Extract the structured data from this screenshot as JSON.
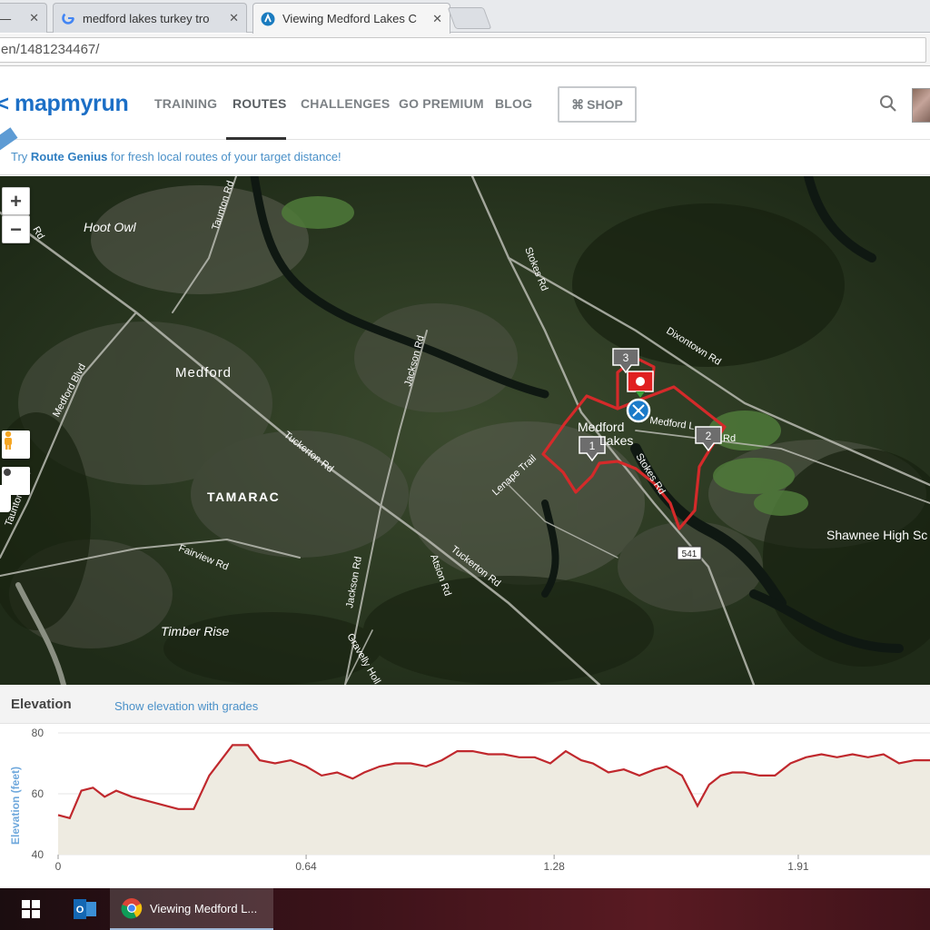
{
  "browser": {
    "tabs": [
      {
        "title": "k —",
        "favicon": "page-icon"
      },
      {
        "title": "medford lakes turkey tro",
        "favicon": "google-g-icon"
      },
      {
        "title": "Viewing Medford Lakes C",
        "favicon": "mapmyrun-icon"
      }
    ],
    "url": "en/1481234467/"
  },
  "site": {
    "logo": "mapmyrun",
    "nav": [
      "TRAINING",
      "ROUTES",
      "CHALLENGES",
      "GO PREMIUM",
      "BLOG"
    ],
    "active_nav": "ROUTES",
    "shop_label": "SHOP",
    "brand_color": "#1c6fc6"
  },
  "banner": {
    "prefix": "Try ",
    "highlight": "Route Genius",
    "suffix": " for fresh local routes of your target distance!"
  },
  "map": {
    "zoom_in": "+",
    "zoom_out": "−",
    "place_labels": {
      "hoot_owl": "Hoot Owl",
      "medford": "Medford",
      "tamarac": "TAMARAC",
      "timber_rise": "Timber Rise",
      "medford_lakes_1": "Medford",
      "medford_lakes_2": "Lakes",
      "shawnee": "Shawnee High Sc"
    },
    "road_labels": {
      "taunton_rd": "Taunton Rd",
      "stokes_rd_n": "Stokes Rd",
      "dixontown_rd": "Dixontown Rd",
      "jackson_rd_n": "Jackson Rd",
      "medford_blvd": "Medford Blvd",
      "tuckerton_rd_1": "Tuckerton Rd",
      "tuckerton_rd_2": "Tuckerton Rd",
      "taunton_blvd": "Taunton Blvd",
      "fairview_rd": "Fairview Rd",
      "jackson_rd_s": "Jackson Rd",
      "atsion_rd": "Atsion Rd",
      "gravelly_holl": "Gravelly Holl",
      "lenape_trail": "Lenape Trail",
      "stokes_rd_s": "Stokes Rd",
      "medford_lakes_rd": "Medford L",
      "rd_suffix": "Rd",
      "route_541": "541",
      "rd_stub": "Rd"
    },
    "markers": [
      "1",
      "2",
      "3"
    ],
    "route_color": "#d42a2a"
  },
  "elevation": {
    "title": "Elevation",
    "grades_link": "Show elevation with grades"
  },
  "chart_data": {
    "type": "area",
    "ylabel": "Elevation (feet)",
    "xlabel": "",
    "ylim": [
      40,
      80
    ],
    "xlim": [
      0,
      2.25
    ],
    "yticks": [
      40,
      60,
      80
    ],
    "xticks": [
      "0",
      "0.64",
      "1.28",
      "1.91"
    ],
    "xtick_values": [
      0,
      0.64,
      1.28,
      1.91
    ],
    "grid": true,
    "series": [
      {
        "line_color": "#c0282d",
        "fill_color": "#eeebe1",
        "x": [
          0,
          0.03,
          0.06,
          0.09,
          0.12,
          0.15,
          0.19,
          0.25,
          0.31,
          0.35,
          0.39,
          0.45,
          0.49,
          0.52,
          0.56,
          0.6,
          0.64,
          0.68,
          0.72,
          0.76,
          0.79,
          0.83,
          0.87,
          0.91,
          0.95,
          0.99,
          1.03,
          1.07,
          1.11,
          1.15,
          1.19,
          1.23,
          1.27,
          1.31,
          1.35,
          1.38,
          1.42,
          1.46,
          1.5,
          1.54,
          1.57,
          1.61,
          1.65,
          1.68,
          1.71,
          1.74,
          1.77,
          1.81,
          1.85,
          1.89,
          1.93,
          1.97,
          2.01,
          2.05,
          2.09,
          2.13,
          2.17,
          2.21,
          2.25
        ],
        "values": [
          53,
          52,
          61,
          62,
          59,
          61,
          59,
          57,
          55,
          55,
          66,
          76,
          76,
          71,
          70,
          71,
          69,
          66,
          67,
          65,
          67,
          69,
          70,
          70,
          69,
          71,
          74,
          74,
          73,
          73,
          72,
          72,
          70,
          74,
          71,
          70,
          67,
          68,
          66,
          68,
          69,
          66,
          56,
          63,
          66,
          67,
          67,
          66,
          66,
          70,
          72,
          73,
          72,
          73,
          72,
          73,
          70,
          71,
          71
        ]
      }
    ]
  },
  "taskbar": {
    "chrome_label": "Viewing Medford L..."
  }
}
